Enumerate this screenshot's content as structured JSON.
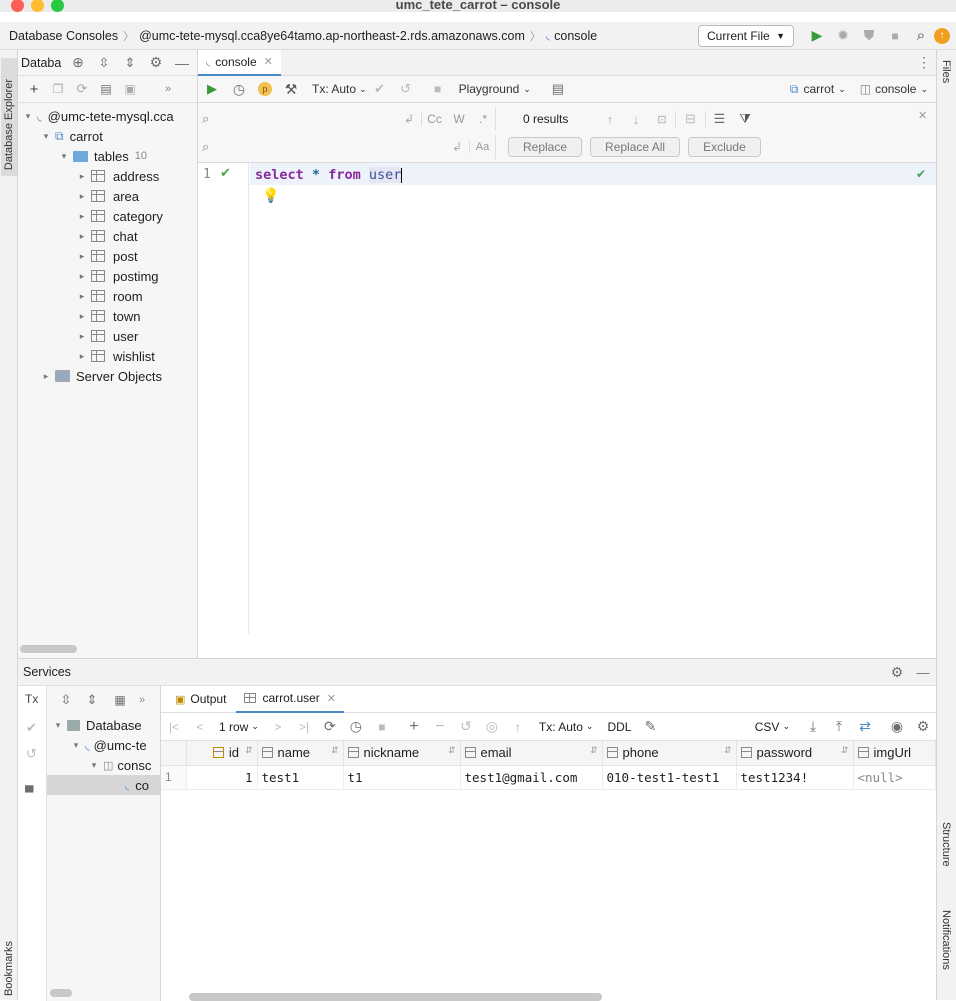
{
  "window": {
    "title": "umc_tete_carrot – console"
  },
  "navbar": {
    "crumbs": [
      "Database Consoles",
      "@umc-tete-mysql.cca8ye64tamo.ap-northeast-2.rds.amazonaws.com",
      "console"
    ],
    "run_config": "Current File"
  },
  "left_strip": {
    "database_explorer": "Database Explorer",
    "bookmarks": "Bookmarks"
  },
  "right_strip": {
    "files": "Files",
    "structure": "Structure",
    "notifications": "Notifications"
  },
  "db_panel": {
    "title": "Databa",
    "tree": {
      "connection": "@umc-tete-mysql.cca",
      "schema": "carrot",
      "tables_label": "tables",
      "tables_count": "10",
      "tables": [
        "address",
        "area",
        "category",
        "chat",
        "post",
        "postimg",
        "room",
        "town",
        "user",
        "wishlist"
      ],
      "server_objects": "Server Objects"
    }
  },
  "editor": {
    "tab_label": "console",
    "tx_mode": "Tx: Auto",
    "playground": "Playground",
    "schema_select": "carrot",
    "session_select": "console",
    "find": {
      "results": "0 results",
      "replace": "Replace",
      "replace_all": "Replace All",
      "exclude": "Exclude"
    },
    "line_number": "1",
    "query": {
      "select": "select",
      "star": "*",
      "from": "from",
      "table": "user"
    }
  },
  "services": {
    "title": "Services",
    "tree": {
      "root": "Database",
      "conn": "@umc-te",
      "console": "consc",
      "session": "co"
    },
    "tabs": {
      "output": "Output",
      "result": "carrot.user"
    },
    "grid_toolbar": {
      "rows": "1 row",
      "tx": "Tx: Auto",
      "ddl": "DDL",
      "export": "CSV"
    },
    "grid": {
      "columns": [
        "id",
        "name",
        "nickname",
        "email",
        "phone",
        "password",
        "imgUrl"
      ],
      "rows": [
        {
          "num": "1",
          "cells": [
            "1",
            "test1",
            "t1",
            "test1@gmail.com",
            "010-test1-test1",
            "test1234!",
            "<null>"
          ]
        }
      ]
    }
  }
}
